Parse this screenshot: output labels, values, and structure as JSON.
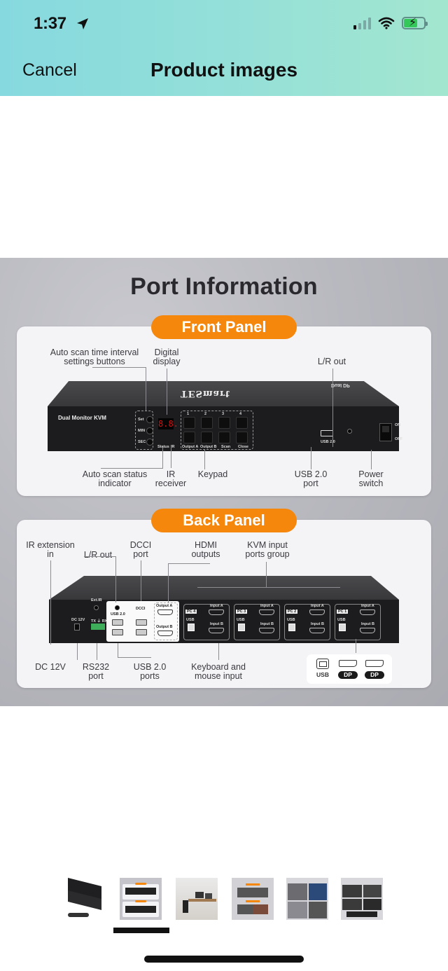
{
  "status_bar": {
    "time": "1:37",
    "location_icon": "location-arrow-icon",
    "signal_icon": "cellular-signal-icon",
    "wifi_icon": "wifi-icon",
    "battery_icon": "battery-charging-icon",
    "battery_charging": true
  },
  "nav": {
    "cancel_label": "Cancel",
    "title": "Product images"
  },
  "colors": {
    "header_gradient_start": "#86d9df",
    "header_gradient_end": "#a3e6cf",
    "accent_orange": "#f5870d",
    "battery_green": "#34c759"
  },
  "product_image": {
    "title": "Port Information",
    "device_name": "Dual Monitor KVM",
    "brand": "TESmart",
    "front_panel": {
      "heading": "Front Panel",
      "labels": {
        "auto_scan_buttons": "Auto scan time interval\nsettings buttons",
        "digital_display": "Digital\ndisplay",
        "lr_out": "L/R out",
        "auto_scan_status": "Auto scan status\nindicator",
        "ir_receiver": "IR\nreceiver",
        "keypad": "Keypad",
        "usb_port": "USB 2.0\nport",
        "power_switch": "Power\nswitch"
      },
      "device_text": {
        "set": "Set",
        "min": "MIN",
        "sec": "SEC",
        "display_value": "8.8.",
        "status": "Status",
        "ir": "IR",
        "keys_top": [
          "1",
          "2",
          "3",
          "4"
        ],
        "keys_bottom": [
          "Output A",
          "Output B",
          "Scan",
          "Close"
        ],
        "usb": "USB 2.0",
        "on": "ON",
        "off": "OFF",
        "dual_dp": "Dual DP"
      }
    },
    "back_panel": {
      "heading": "Back Panel",
      "labels": {
        "ir_ext": "IR extension\nin",
        "lr_out": "L/R out",
        "dcci": "DCCI\nport",
        "hdmi_out": "HDMI\noutputs",
        "kvm_group": "KVM input\nports group",
        "dc12v": "DC 12V",
        "rs232": "RS232\nport",
        "usb_ports": "USB 2.0\nports",
        "kb_mouse": "Keyboard and\nmouse input"
      },
      "device_text": {
        "ext_ir": "Ext.IR",
        "dc": "DC 12V",
        "txrx": "TX ⏚ RX",
        "usb20": "USB 2.0",
        "dcci": "DCCI",
        "output_a": "Output A",
        "output_b": "Output B",
        "pcs": [
          "PC 4",
          "PC 3",
          "PC 2",
          "PC 1"
        ],
        "input_a": "Input A",
        "input_b": "Input B",
        "usb": "USB"
      },
      "legend": [
        "USB",
        "DP",
        "DP"
      ]
    }
  },
  "thumbnails": {
    "selected_index": 1,
    "items": [
      {
        "alt": "KVM switch with cables"
      },
      {
        "alt": "Port Information"
      },
      {
        "alt": "Dual Monitor KVM Expand Space"
      },
      {
        "alt": "Meet 2 Display Needs"
      },
      {
        "alt": "Quick and Easy Switch"
      },
      {
        "alt": "Keyboard and Mouse Pass Through Technology"
      }
    ]
  }
}
